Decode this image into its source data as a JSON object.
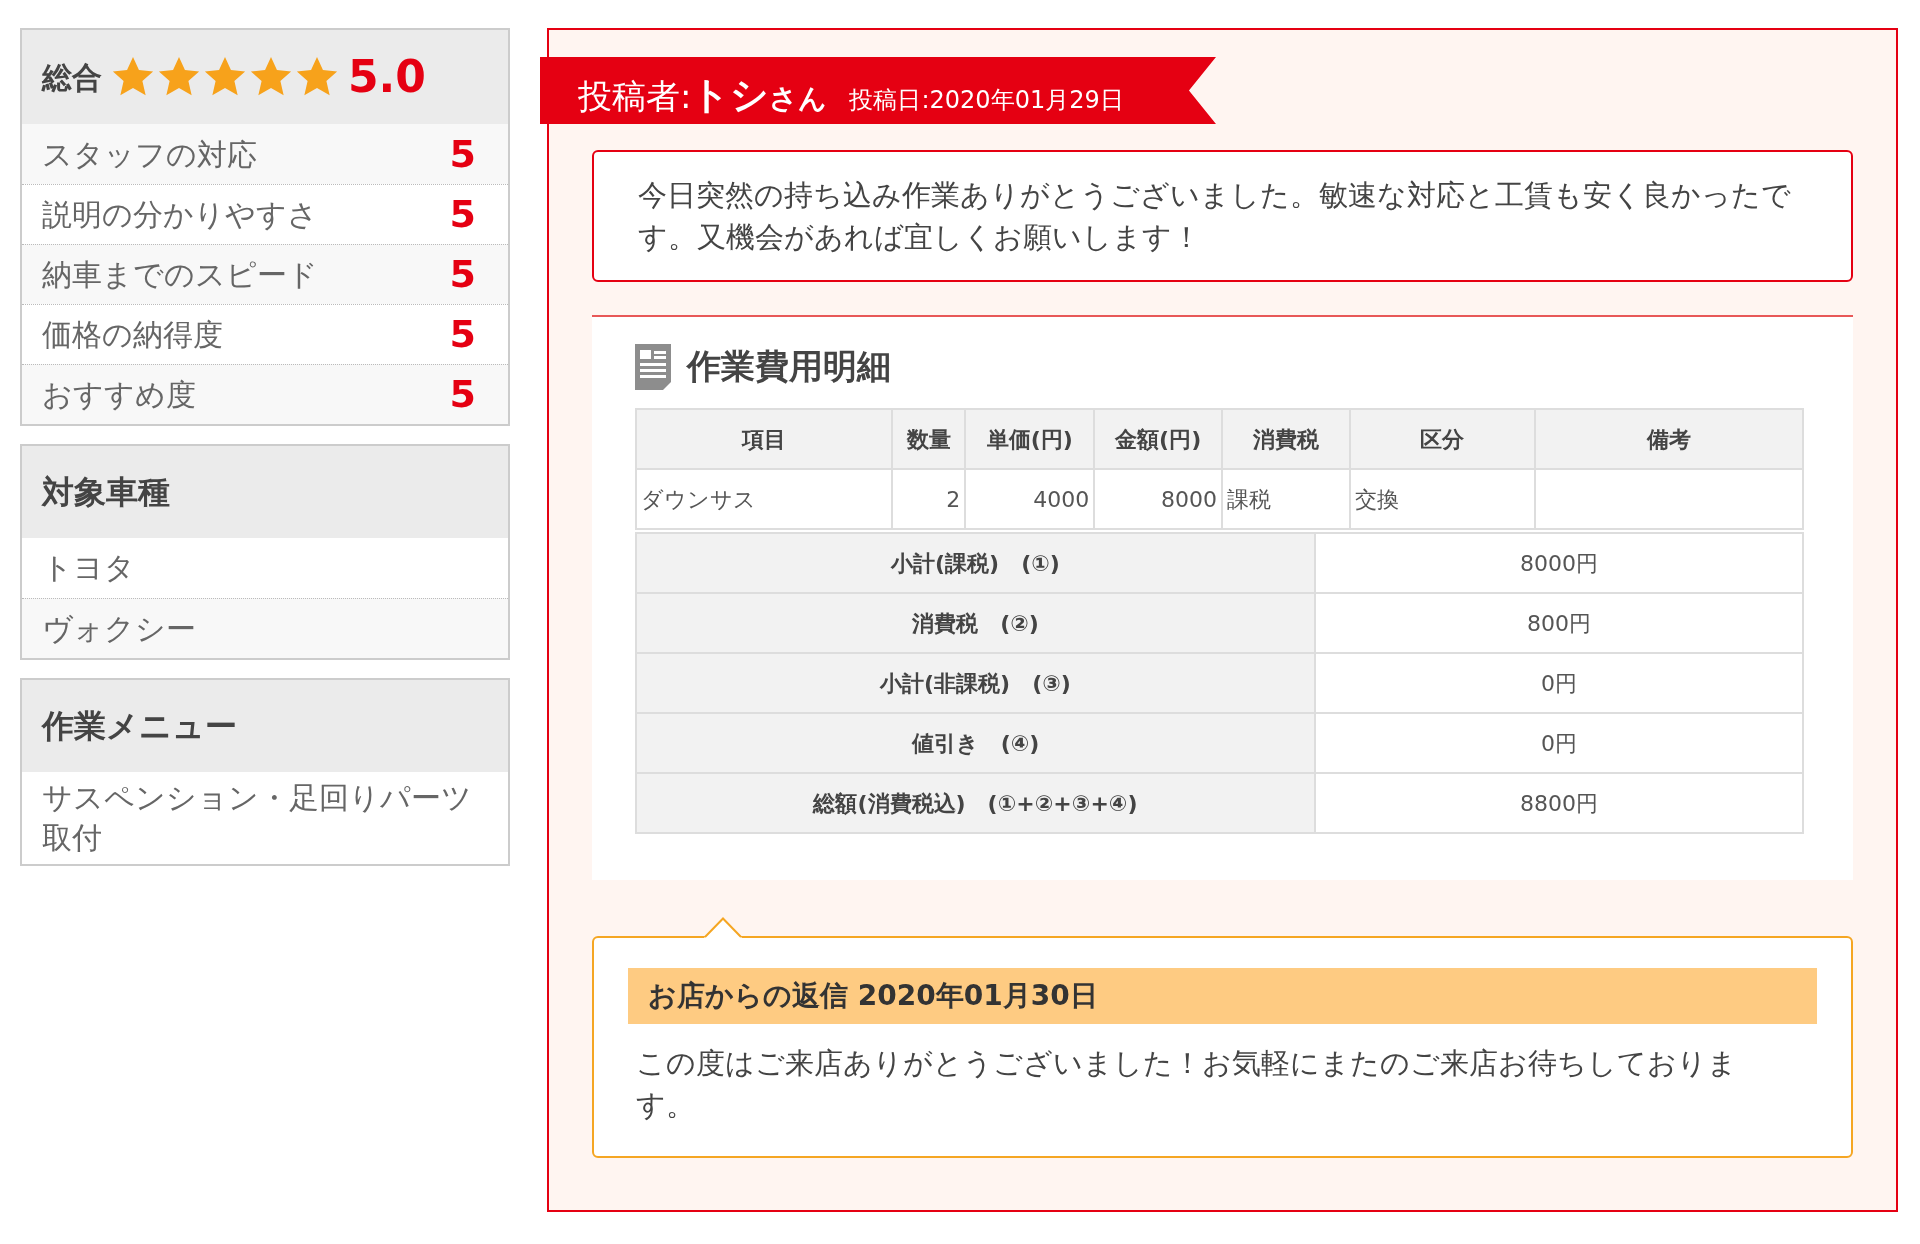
{
  "ratings": {
    "label": "総合",
    "stars": 5,
    "score": "5.0",
    "items": [
      {
        "label": "スタッフの対応",
        "value": "5"
      },
      {
        "label": "説明の分かりやすさ",
        "value": "5"
      },
      {
        "label": "納車までのスピード",
        "value": "5"
      },
      {
        "label": "価格の納得度",
        "value": "5"
      },
      {
        "label": "おすすめ度",
        "value": "5"
      }
    ]
  },
  "vehicle": {
    "title": "対象車種",
    "items": [
      "トヨタ",
      "ヴォクシー"
    ]
  },
  "menu": {
    "title": "作業メニュー",
    "items": [
      "サスペンション・足回りパーツ取付"
    ]
  },
  "review": {
    "poster_label": "投稿者:",
    "poster_name": "トシ",
    "poster_suffix": "さん",
    "date": "投稿日:2020年01月29日",
    "comment": "今日突然の持ち込み作業ありがとうございました。敏速な対応と工賃も安く良かったです。又機会があれば宜しくお願いします！"
  },
  "costs": {
    "title": "作業費用明細",
    "columns": [
      "項目",
      "数量",
      "単価(円)",
      "金額(円)",
      "消費税",
      "区分",
      "備考"
    ],
    "rows": [
      [
        "ダウンサス",
        "2",
        "4000",
        "8000",
        "課税",
        "交換",
        ""
      ]
    ],
    "summary": [
      {
        "label": "小計(課税)　(①)",
        "value": "8000円"
      },
      {
        "label": "消費税　(②)",
        "value": "800円"
      },
      {
        "label": "小計(非課税)　(③)",
        "value": "0円"
      },
      {
        "label": "値引き　(④)",
        "value": "0円"
      },
      {
        "label": "総額(消費税込)　(①+②+③+④)",
        "value": "8800円"
      }
    ]
  },
  "reply": {
    "title": "お店からの返信 2020年01月30日",
    "text": "この度はご来店ありがとうございました！お気軽にまたのご来店お待ちしております。"
  }
}
